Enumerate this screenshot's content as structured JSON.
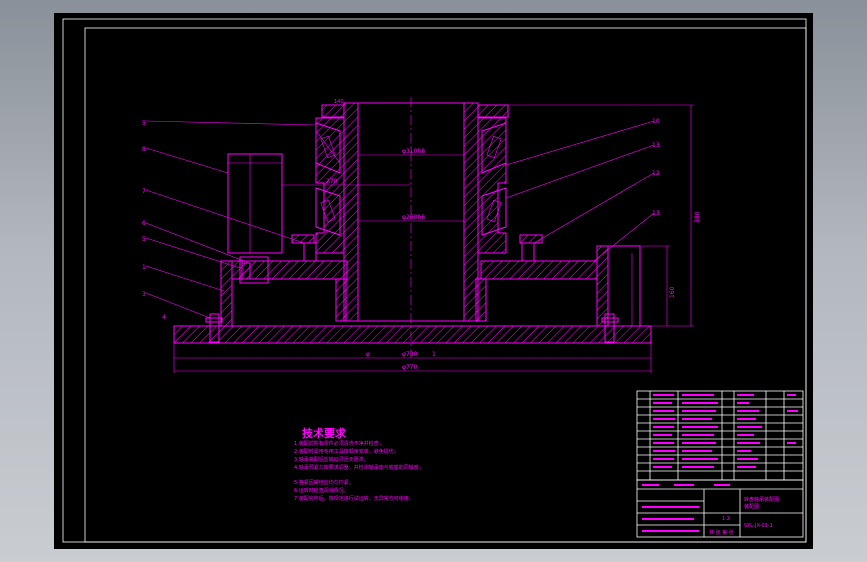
{
  "drawing": {
    "part_labels_left": [
      "5",
      "8",
      "7",
      "6",
      "5",
      "1",
      "3",
      "4"
    ],
    "part_labels_right": [
      "10",
      "13",
      "12",
      "13"
    ],
    "dimensions": {
      "top_small": "140",
      "bore_upper": "φ310h6",
      "inner_width": "270",
      "bore_lower": "φ260h6",
      "overall_height": "380",
      "side_height": "160",
      "base_inner": "φ730",
      "base_outer": "φ770",
      "mark_a": "φ",
      "mark_b": "1"
    },
    "tech_title": "技术要求",
    "tech_notes": [
      "1.装配前所有零件必须清洗干净并检查；",
      "2.装配时需用专用工具按顺序安装，避免损伤；",
      "3.轴承装配后应转动灵活无阻滞；",
      "4.轴承预紧力按要求调整，并检测轴承座与底座的同轴度；",
      "5.各紧固螺栓应均匀拧紧；",
      "6.运转时检查润滑情况；",
      "7.装配完毕后，按规定进行试运转，无异常方可使用。"
    ],
    "title_block": {
      "drawing_name": "转盘轴承装配图",
      "sub_name": "装配图",
      "code": "SYL-JX-03-1",
      "scale": "1:2",
      "sheet_label": "共 张 第 张"
    }
  },
  "colors": {
    "line": "#ff00ff",
    "frame": "#ffffff",
    "background": "#000000"
  }
}
